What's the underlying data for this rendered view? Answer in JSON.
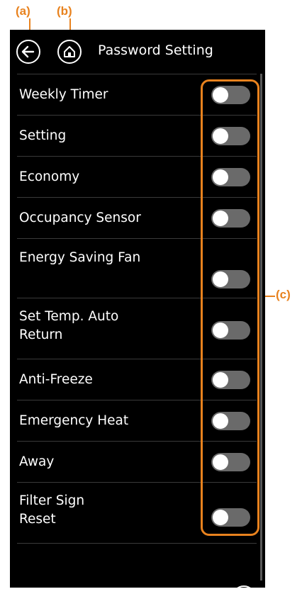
{
  "callouts": {
    "a": "(a)",
    "b": "(b)",
    "c": "(c)"
  },
  "header": {
    "title": "Password Setting",
    "back_icon": "arrow-left-icon",
    "home_icon": "home-icon"
  },
  "settings": [
    {
      "label": "Weekly Timer",
      "enabled": false
    },
    {
      "label": "Setting",
      "enabled": false
    },
    {
      "label": "Economy",
      "enabled": false
    },
    {
      "label": "Occupancy Sensor",
      "enabled": false
    },
    {
      "label": "Energy Saving Fan",
      "enabled": false
    },
    {
      "label": "Set Temp. Auto\nReturn",
      "enabled": false
    },
    {
      "label": "Anti-Freeze",
      "enabled": false
    },
    {
      "label": "Emergency Heat",
      "enabled": false
    },
    {
      "label": "Away",
      "enabled": false
    },
    {
      "label": "Filter Sign\nReset",
      "enabled": false
    }
  ],
  "footer": {
    "scroll_top_icon": "arrow-up-to-top-icon"
  },
  "colors": {
    "accent": "#e8821e",
    "background": "#000000",
    "toggle_off": "#6a6a6a",
    "text": "#ffffff"
  }
}
